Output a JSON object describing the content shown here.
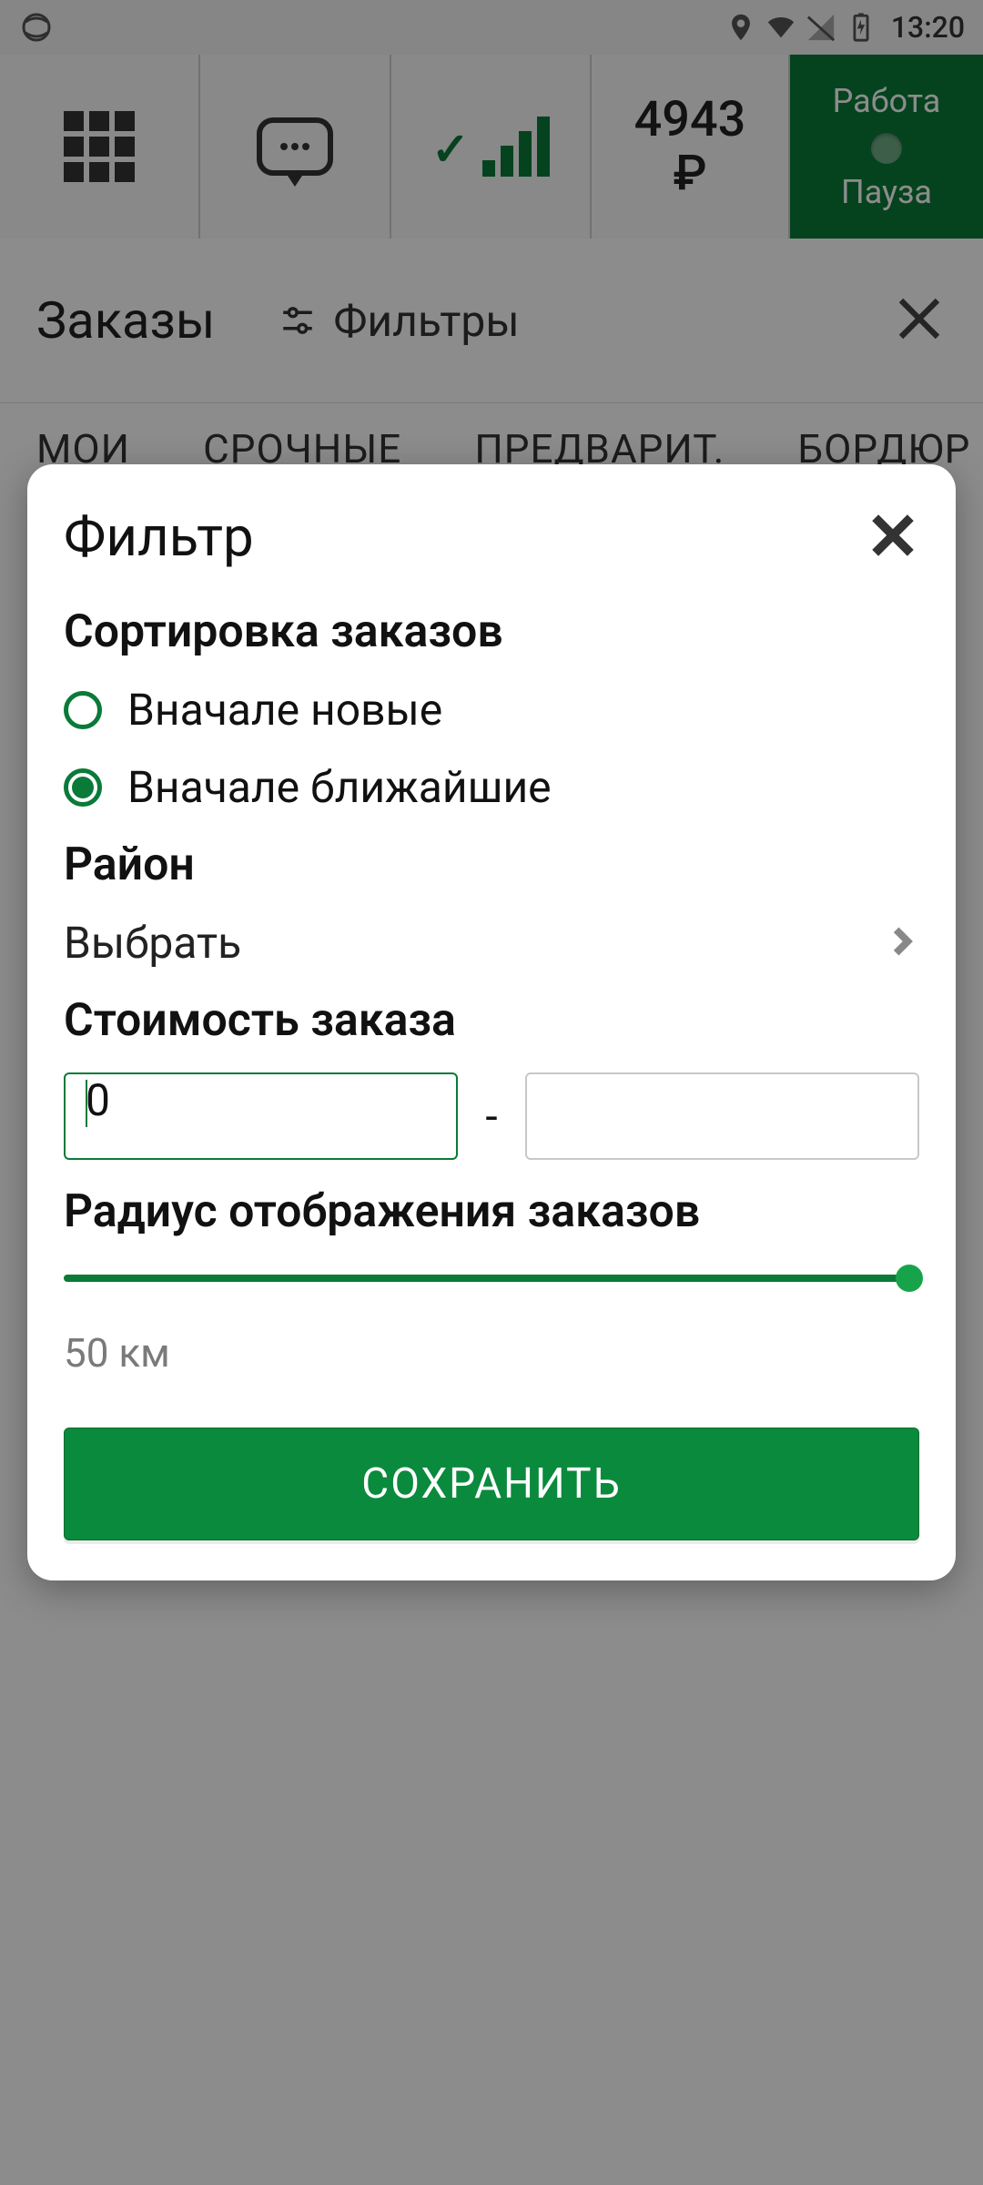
{
  "status": {
    "time": "13:20"
  },
  "topbar": {
    "balance": "4943",
    "currency": "₽",
    "work_label": "Работа",
    "pause_label": "Пауза"
  },
  "orders": {
    "title": "Заказы",
    "filters_label": "Фильтры"
  },
  "tabs": [
    "МОИ",
    "СРОЧНЫЕ",
    "ПРЕДВАРИТ.",
    "БОРДЮР"
  ],
  "modal": {
    "title": "Фильтр",
    "sort_heading": "Сортировка заказов",
    "radio_new": "Вначале новые",
    "radio_near": "Вначале ближайшие",
    "district_heading": "Район",
    "district_select_label": "Выбрать",
    "price_heading": "Стоимость заказа",
    "price_from": "0",
    "price_to": "",
    "price_dash": "-",
    "radius_heading": "Радиус отображения заказов",
    "radius_value": "50 км",
    "save_label": "СОХРАНИТЬ"
  }
}
